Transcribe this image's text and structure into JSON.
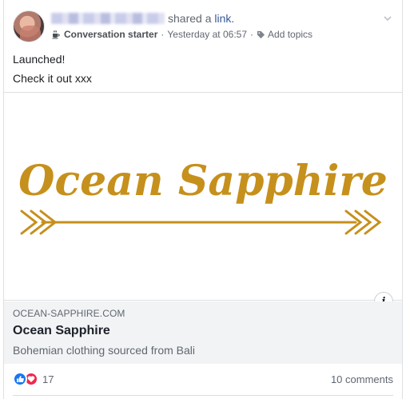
{
  "post": {
    "shared_text": "shared a",
    "link_word": "link.",
    "category": "Conversation starter",
    "timestamp": "Yesterday at 06:57",
    "add_topics": "Add topics",
    "lines": [
      "Launched!",
      "Check it out xxx"
    ]
  },
  "preview": {
    "logo_text": "Ocean Sapphire",
    "domain": "OCEAN-SAPPHIRE.COM",
    "title": "Ocean Sapphire",
    "description": "Bohemian clothing sourced from Bali",
    "info_label": "i",
    "logo_color": "#c6901c"
  },
  "footer": {
    "reaction_count": "17",
    "comments": "10 comments"
  },
  "icons": {
    "cup": "coffee-cup-icon",
    "tag": "tag-icon",
    "chevron": "chevron-down-icon",
    "like": "like-icon",
    "love": "love-icon",
    "info": "info-icon"
  }
}
